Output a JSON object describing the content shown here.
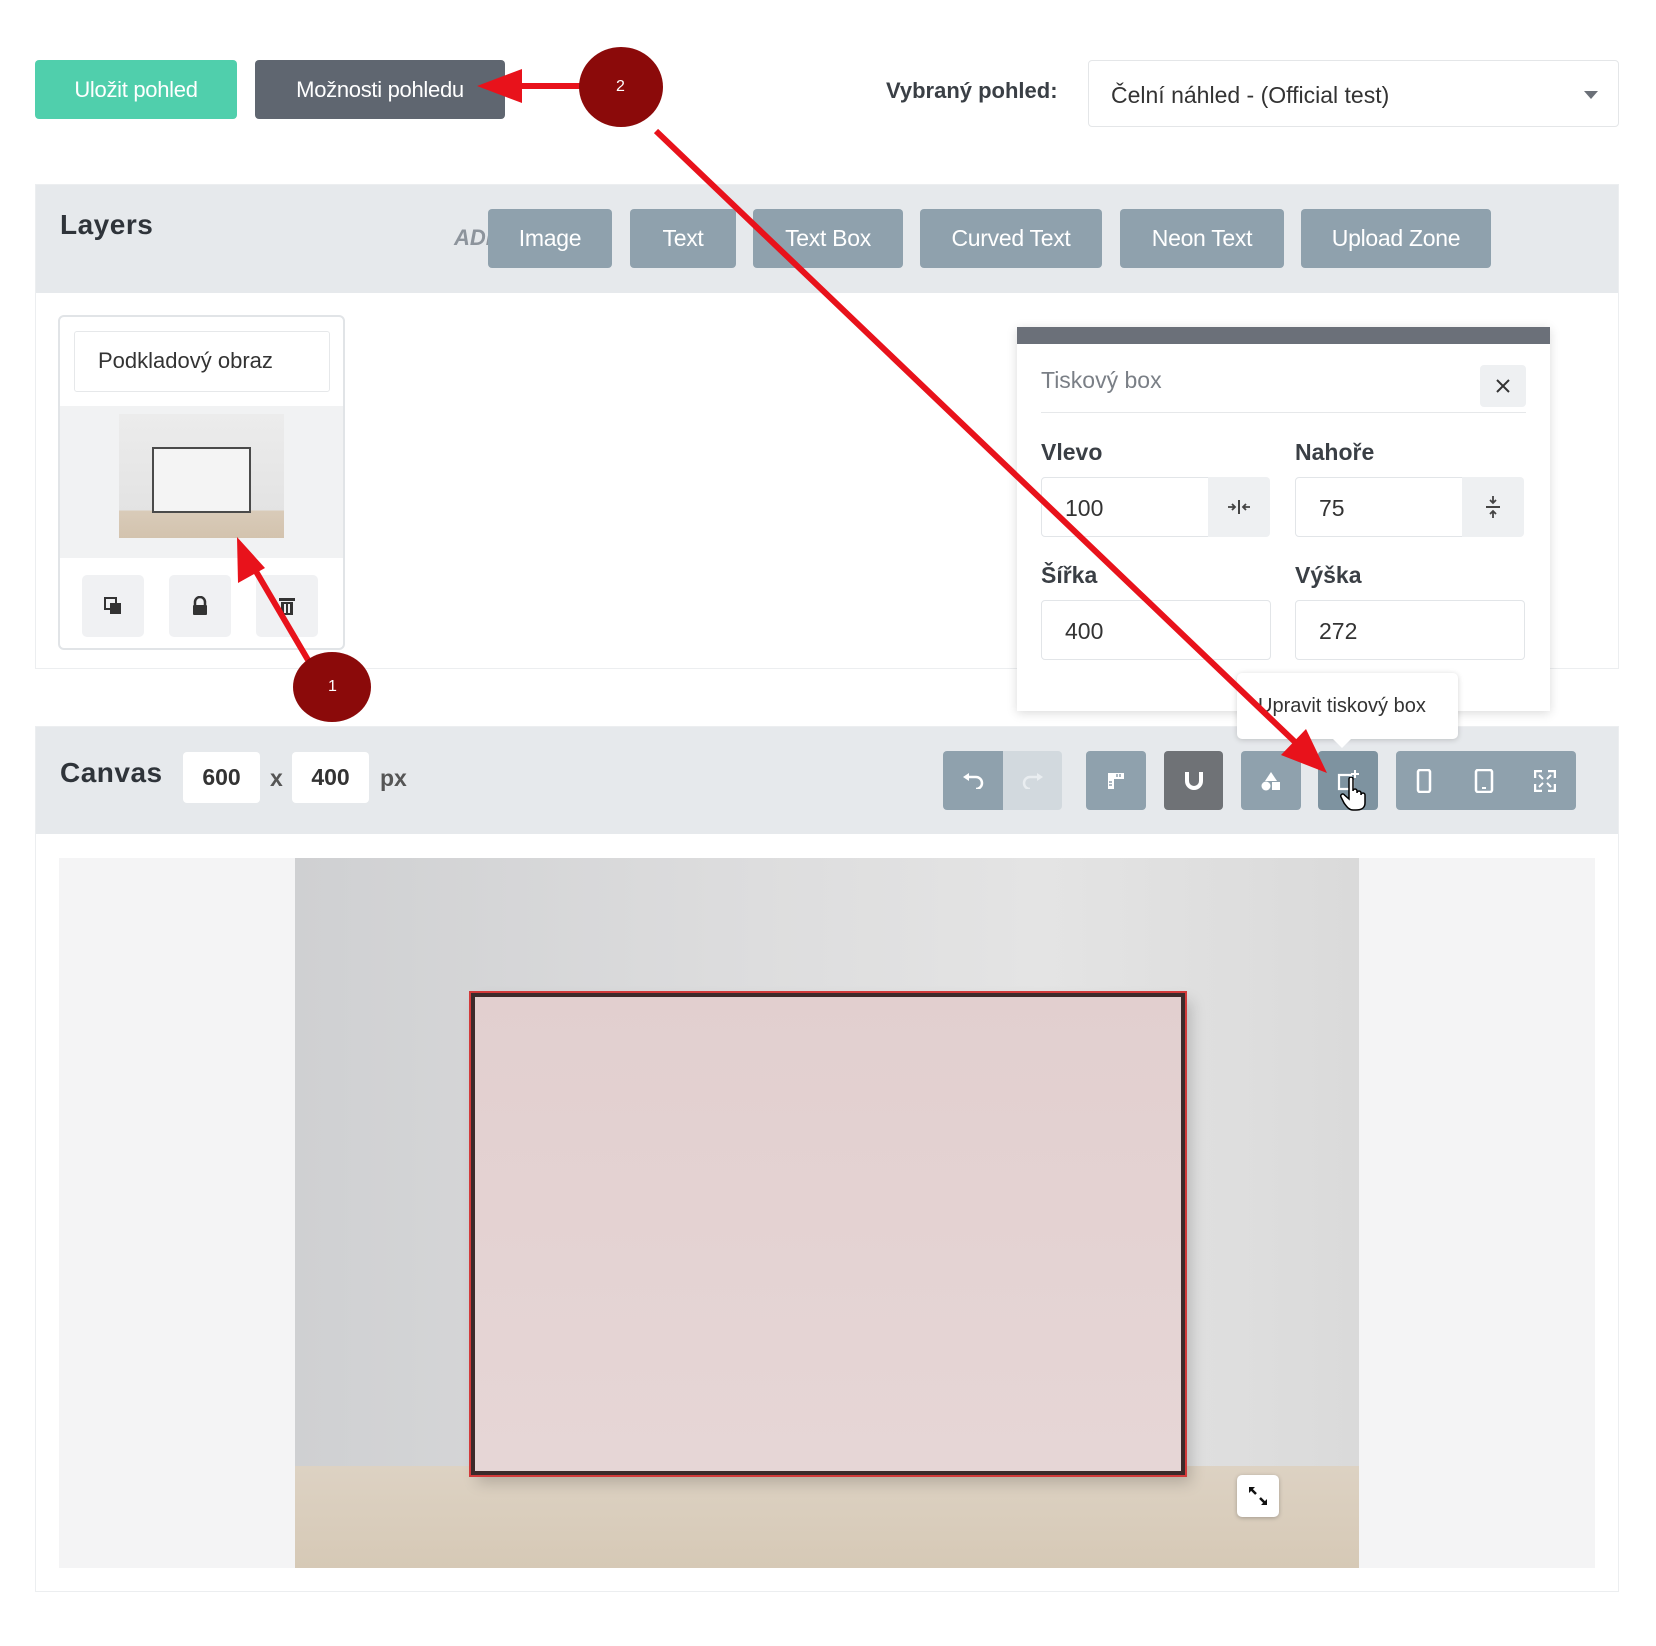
{
  "toolbar": {
    "save_label": "Uložit pohled",
    "options_label": "Možnosti pohledu",
    "selected_view_label": "Vybraný pohled:",
    "selected_view_value": "Čelní náhled - (Official test)"
  },
  "layers": {
    "title": "Layers",
    "add_label": "ADD",
    "add_buttons": [
      "Image",
      "Text",
      "Text Box",
      "Curved Text",
      "Neon Text",
      "Upload Zone"
    ],
    "card": {
      "name": "Podkladový obraz",
      "actions": [
        "duplicate-icon",
        "lock-icon",
        "trash-icon"
      ]
    }
  },
  "printbox": {
    "title": "Tiskový box",
    "left_label": "Vlevo",
    "left_value": "100",
    "top_label": "Nahoře",
    "top_value": "75",
    "width_label": "Šířka",
    "width_value": "400",
    "height_label": "Výška",
    "height_value": "272"
  },
  "tooltip": {
    "text": "Upravit tiskový box"
  },
  "canvas": {
    "title": "Canvas",
    "width": "600",
    "separator": "x",
    "height": "400",
    "unit": "px",
    "tools": [
      "undo-icon",
      "redo-icon",
      "ruler-icon",
      "magnet-icon",
      "shapes-icon",
      "printbox-icon",
      "phone-icon",
      "tablet-icon",
      "fullscreen-icon"
    ]
  },
  "annotations": {
    "marker_1": "1",
    "marker_2": "2",
    "color": "#e8121b",
    "marker_color": "#8b0a0a"
  },
  "colors": {
    "save_button": "#50cfac",
    "options_button": "#5f6670",
    "add_button": "#8fa1ad",
    "panel_header": "#e6e9ec",
    "active_tool": "#6f7276"
  }
}
